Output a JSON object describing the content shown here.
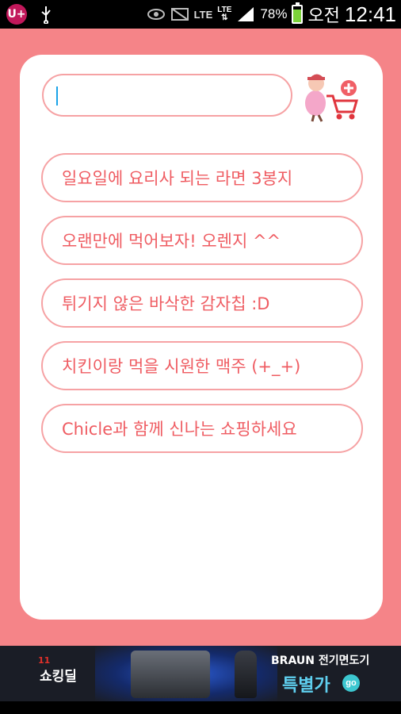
{
  "status_bar": {
    "carrier_badge": "U+",
    "network_label": "LTE",
    "lte_label": "LTE",
    "battery_percent": "78%",
    "battery_level": 0.78,
    "ampm": "오전",
    "time": "12:41",
    "icons": [
      "uplus-icon",
      "usb-icon",
      "eye-icon",
      "mute-icon",
      "signal-icon",
      "battery-icon"
    ]
  },
  "search": {
    "value": "",
    "placeholder": ""
  },
  "suggestions": [
    "일요일에 요리사 되는 라면 3봉지",
    "오랜만에 먹어보자! 오렌지 ^^",
    "튀기지 않은 바삭한 감자칩 :D",
    "치킨이랑 먹을 시원한 맥주 (+_+)",
    "Chicle과 함께 신나는 쇼핑하세요"
  ],
  "ad": {
    "logo_text": "쇼킹딜",
    "logo_tag": "11",
    "brand": "BRAUN 전기면도기",
    "promo": "특별가",
    "go": "go"
  },
  "colors": {
    "background": "#f58488",
    "accent_text": "#ef5c62",
    "pill_border": "#f6a2a4",
    "caret": "#1aa3e8"
  }
}
